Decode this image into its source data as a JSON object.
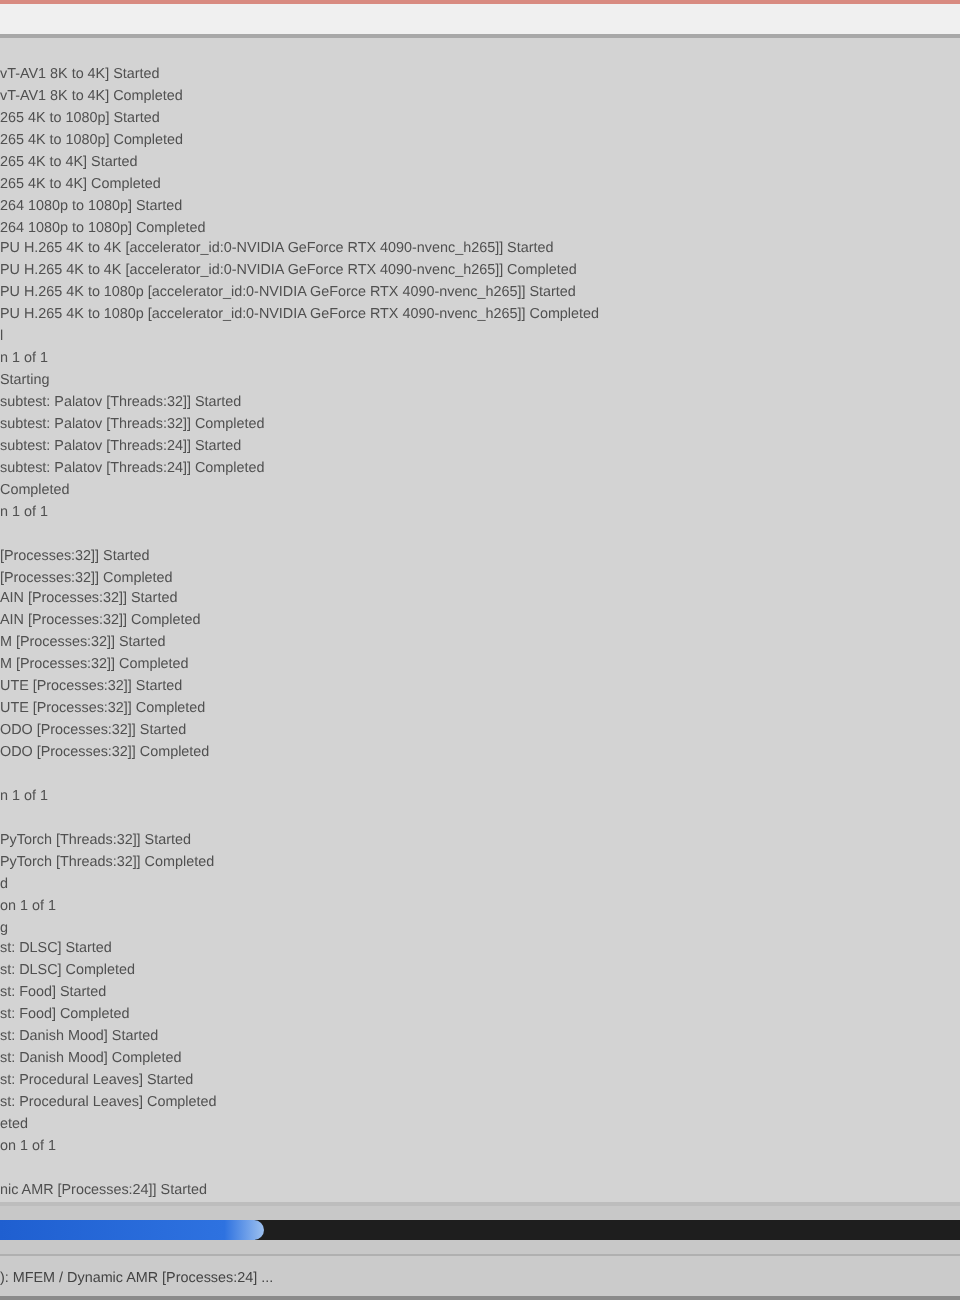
{
  "log": [
    {
      "kind": "blank"
    },
    {
      "kind": "line",
      "text": "vT-AV1 8K to 4K] Started"
    },
    {
      "kind": "line",
      "text": "vT-AV1 8K to 4K] Completed"
    },
    {
      "kind": "line",
      "text": "265 4K to 1080p] Started"
    },
    {
      "kind": "line",
      "text": "265 4K to 1080p] Completed"
    },
    {
      "kind": "line",
      "text": "265 4K to 4K] Started"
    },
    {
      "kind": "line",
      "text": "265 4K to 4K] Completed"
    },
    {
      "kind": "line",
      "text": "264 1080p to 1080p] Started"
    },
    {
      "kind": "line",
      "text": "264 1080p to 1080p] Completed"
    },
    {
      "kind": "line",
      "text": "PU H.265 4K to 4K [accelerator_id:0-NVIDIA GeForce RTX 4090-nvenc_h265]] Started"
    },
    {
      "kind": "line",
      "text": "PU H.265 4K to 4K [accelerator_id:0-NVIDIA GeForce RTX 4090-nvenc_h265]] Completed"
    },
    {
      "kind": "line",
      "text": "PU H.265 4K to 1080p [accelerator_id:0-NVIDIA GeForce RTX 4090-nvenc_h265]] Started"
    },
    {
      "kind": "line",
      "text": "PU H.265 4K to 1080p [accelerator_id:0-NVIDIA GeForce RTX 4090-nvenc_h265]] Completed"
    },
    {
      "kind": "line",
      "text": "l"
    },
    {
      "kind": "line",
      "text": "n 1 of 1"
    },
    {
      "kind": "line",
      "text": "Starting"
    },
    {
      "kind": "line",
      "text": "subtest: Palatov [Threads:32]] Started"
    },
    {
      "kind": "line",
      "text": "subtest: Palatov [Threads:32]] Completed"
    },
    {
      "kind": "line",
      "text": "subtest: Palatov [Threads:24]] Started"
    },
    {
      "kind": "line",
      "text": "subtest: Palatov [Threads:24]] Completed"
    },
    {
      "kind": "line",
      "text": "Completed"
    },
    {
      "kind": "line",
      "text": "n 1 of 1"
    },
    {
      "kind": "blank"
    },
    {
      "kind": "line",
      "text": "[Processes:32]] Started"
    },
    {
      "kind": "line",
      "text": "[Processes:32]] Completed"
    },
    {
      "kind": "line",
      "text": "AIN [Processes:32]] Started"
    },
    {
      "kind": "line",
      "text": "AIN [Processes:32]] Completed"
    },
    {
      "kind": "line",
      "text": "M [Processes:32]] Started"
    },
    {
      "kind": "line",
      "text": "M [Processes:32]] Completed"
    },
    {
      "kind": "line",
      "text": "UTE [Processes:32]] Started"
    },
    {
      "kind": "line",
      "text": "UTE [Processes:32]] Completed"
    },
    {
      "kind": "line",
      "text": "ODO [Processes:32]] Started"
    },
    {
      "kind": "line",
      "text": "ODO [Processes:32]] Completed"
    },
    {
      "kind": "blank"
    },
    {
      "kind": "line",
      "text": "n 1 of 1"
    },
    {
      "kind": "blank"
    },
    {
      "kind": "line",
      "text": "PyTorch [Threads:32]] Started"
    },
    {
      "kind": "line",
      "text": "PyTorch [Threads:32]] Completed"
    },
    {
      "kind": "line",
      "text": "d"
    },
    {
      "kind": "line",
      "text": "on 1 of 1"
    },
    {
      "kind": "line",
      "text": "g"
    },
    {
      "kind": "line",
      "text": "st: DLSC] Started"
    },
    {
      "kind": "line",
      "text": "st: DLSC] Completed"
    },
    {
      "kind": "line",
      "text": "st: Food] Started"
    },
    {
      "kind": "line",
      "text": "st: Food] Completed"
    },
    {
      "kind": "line",
      "text": "st: Danish Mood] Started"
    },
    {
      "kind": "line",
      "text": "st: Danish Mood] Completed"
    },
    {
      "kind": "line",
      "text": "st: Procedural Leaves] Started"
    },
    {
      "kind": "line",
      "text": "st: Procedural Leaves] Completed"
    },
    {
      "kind": "line",
      "text": "eted"
    },
    {
      "kind": "line",
      "text": "on 1 of 1"
    },
    {
      "kind": "blank"
    },
    {
      "kind": "line",
      "text": "nic AMR [Processes:24]] Started"
    }
  ],
  "progress": {
    "level": 0.275
  },
  "status_bar": {
    "text": "): MFEM / Dynamic AMR [Processes:24] ..."
  }
}
